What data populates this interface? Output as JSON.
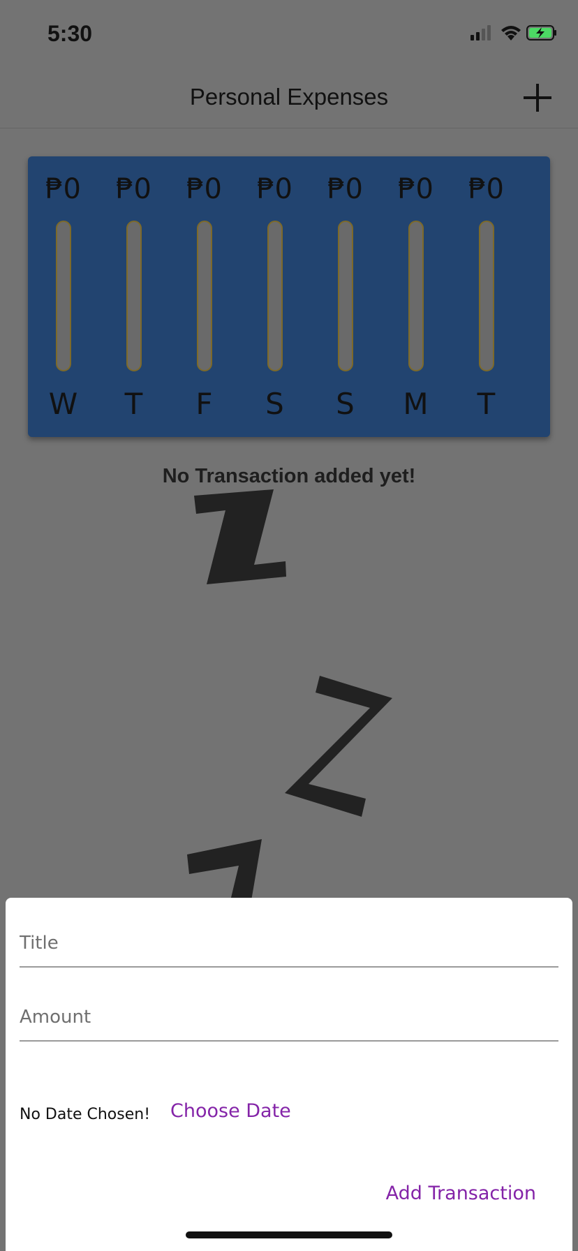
{
  "status_bar": {
    "time": "5:30"
  },
  "app_bar": {
    "title": "Personal Expenses",
    "add_icon": "plus-icon"
  },
  "chart": {
    "accent": "#224470",
    "bar_color": "#c9a227"
  },
  "chart_data": {
    "type": "bar",
    "categories": [
      "W",
      "T",
      "F",
      "S",
      "S",
      "M",
      "T"
    ],
    "values": [
      0,
      0,
      0,
      0,
      0,
      0,
      0
    ],
    "value_labels": [
      "₱0",
      "₱0",
      "₱0",
      "₱0",
      "₱0",
      "₱0",
      "₱0"
    ]
  },
  "empty_state": {
    "message": "No Transaction added yet!",
    "illustration": "sleeping-zzz"
  },
  "form": {
    "title_placeholder": "Title",
    "title_value": "",
    "amount_placeholder": "Amount",
    "amount_value": "",
    "date_label": "No Date Chosen!",
    "choose_date_label": "Choose Date",
    "submit_label": "Add Transaction",
    "accent": "#8424a8"
  }
}
